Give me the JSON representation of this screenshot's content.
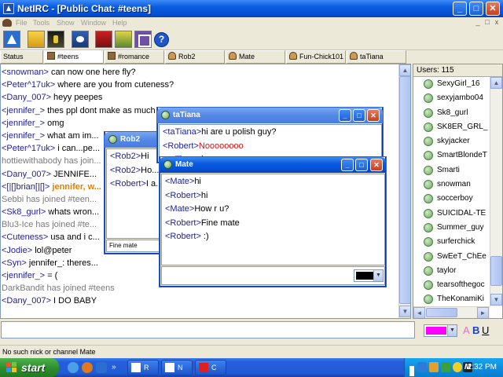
{
  "window": {
    "title": "NetIRC - [Public Chat: #teens]",
    "min_label": "_",
    "max_label": "□",
    "close_label": "✕"
  },
  "menu": {
    "items": [
      "File",
      "Tools",
      "Show",
      "Window",
      "Help"
    ],
    "mini_buttons": [
      "_",
      "□",
      "x"
    ]
  },
  "toolbar": {
    "help_label": "?"
  },
  "tabs": [
    {
      "label": "Status",
      "icon": "none"
    },
    {
      "label": "#teens",
      "icon": "channel-icon"
    },
    {
      "label": "#romance",
      "icon": "channel-icon"
    },
    {
      "label": "Rob2",
      "icon": "user-icon"
    },
    {
      "label": "Mate",
      "icon": "user-icon"
    },
    {
      "label": "Fun-Chick101",
      "icon": "user-icon"
    },
    {
      "label": "taTiana",
      "icon": "user-icon"
    }
  ],
  "chat": {
    "lines": [
      {
        "nick": "<snowman>",
        "text": " can now one here fly?"
      },
      {
        "nick": "<Peter^17uk>",
        "text": " where are you from cuteness?"
      },
      {
        "nick": "<Dany_007>",
        "text": " heyy peepes"
      },
      {
        "nick": "<jennifer_>",
        "text": " thes ppl dont make as much sense as..."
      },
      {
        "nick": "<jennifer_>",
        "text": " omg"
      },
      {
        "nick": "<jennifer_>",
        "text": " what am im..."
      },
      {
        "nick": "<Peter^17uk>",
        "text": " i can...pe..."
      },
      {
        "join": "hottiewithabody has join..."
      },
      {
        "nick": "<Dany_007>",
        "text": " JENNIFE..."
      },
      {
        "nick": "<[|[]brian[|[]>",
        "hl": " jennifer, w..."
      },
      {
        "join": "Sebbi has joined #teen..."
      },
      {
        "nick": "<Sk8_gurl>",
        "text": " whats wron..."
      },
      {
        "join": "Blu3-Ice has joined #te..."
      },
      {
        "nick": "<Cuteness>",
        "text": " usa and i c..."
      },
      {
        "nick": "<Jodie>",
        "text": " lol@peter"
      },
      {
        "nick": "<Syn>",
        "text": " jennifer_: theres..."
      },
      {
        "nick": "<jennifer_>",
        "text": " = ("
      },
      {
        "join": "DarkBandit has joined #teens"
      },
      {
        "nick": "<Dany_007>",
        "text": " I DO BABY"
      }
    ]
  },
  "users": {
    "header": "Users: 115",
    "list": [
      "SexyGirl_16",
      "sexyjambo04",
      "Sk8_gurl",
      "SK8ER_GRL_",
      "skyjacker",
      "SmartBlondeT",
      "Smarti",
      "snowman",
      "soccerboy",
      "SUICIDAL-TE",
      "Summer_guy",
      "surferchick",
      "SwEeT_ChEe",
      "taylor",
      "tearsofthegoc",
      "TheKonamiKi"
    ]
  },
  "scroll": {
    "up": "▲",
    "down": "▼",
    "left": "◄",
    "right": "►"
  },
  "input": {
    "value": "",
    "color": "#ff00ff",
    "format": {
      "a": "A",
      "b": "B",
      "u": "U"
    },
    "dropdown": "▼"
  },
  "status": {
    "text": "No such nick or channel Mate"
  },
  "taskbar": {
    "start": "start",
    "tasks": [
      {
        "label": "R",
        "icon": "netirc-icon"
      },
      {
        "label": "N",
        "icon": "netirc-icon"
      },
      {
        "label": "C",
        "icon": "paint-icon"
      }
    ],
    "tray_letter": "M",
    "clock": "2:32 PM"
  },
  "rob2": {
    "title": "Rob2",
    "lines": [
      {
        "nick": "<Rob2>",
        "text": "Hi"
      },
      {
        "nick": "<Rob2>",
        "text": "Ho..."
      },
      {
        "nick": "<Robert>",
        "text": "I a..."
      }
    ],
    "input_value": "Fine mate"
  },
  "tatiana": {
    "title": "taTiana",
    "lines": [
      {
        "nick": "<taTiana>",
        "text": "hi are u polish guy?"
      },
      {
        "nick": "<Robert>",
        "red": "Noooooooo"
      },
      {
        "nick": "<taTiana>",
        "text": "i see, sorry"
      }
    ]
  },
  "mate": {
    "title": "Mate",
    "lines": [
      {
        "nick": "<Mate>",
        "text": "hi"
      },
      {
        "nick": "<Robert>",
        "text": "hi"
      },
      {
        "nick": "<Mate>",
        "text": "How r u?"
      },
      {
        "nick": "<Robert>",
        "text": "Fine mate"
      },
      {
        "nick": "<Robert>",
        "text": " :)"
      }
    ],
    "color": "#000000"
  }
}
